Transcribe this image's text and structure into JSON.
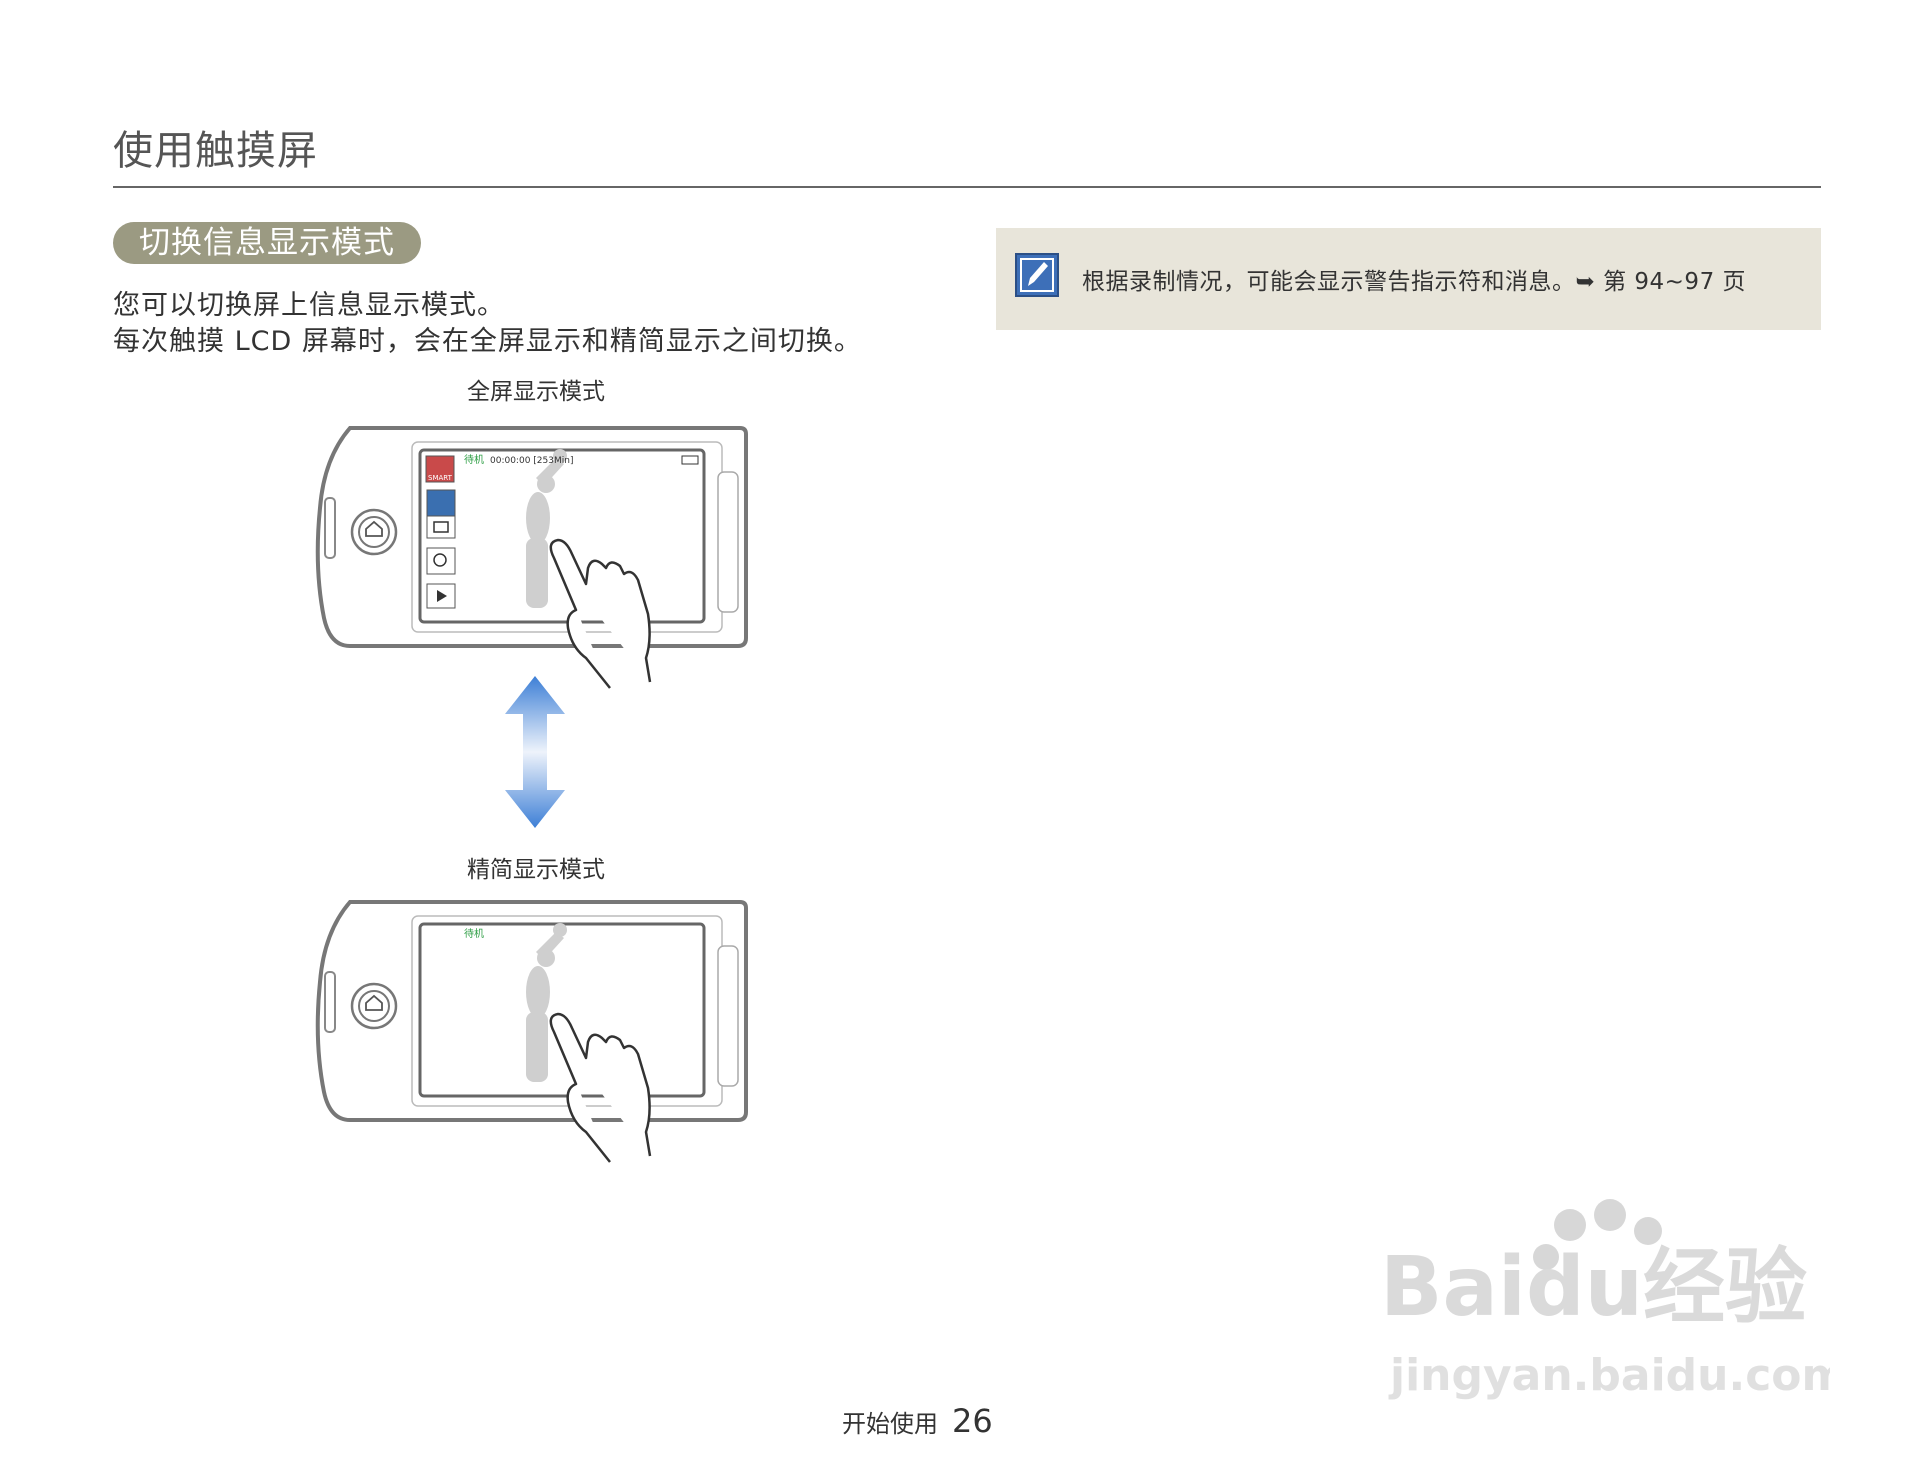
{
  "header": {
    "title": "使用触摸屏"
  },
  "section": {
    "badge": "切换信息显示模式",
    "lines": [
      "您可以切换屏上信息显示模式。",
      "每次触摸 LCD 屏幕时，会在全屏显示和精简显示之间切换。"
    ]
  },
  "figures": {
    "full": {
      "caption": "全屏显示模式",
      "status_label": "待机",
      "status_time": "00:00:00 [253Min]",
      "smart_label": "SMART"
    },
    "simple": {
      "caption": "精简显示模式",
      "status_label": "待机"
    }
  },
  "note": {
    "text": "根据录制情况，可能会显示警告指示符和消息。➥ 第 94~97 页"
  },
  "footer": {
    "section": "开始使用",
    "page": "26"
  },
  "watermark": {
    "brand": "Baidu经验",
    "url": "jingyan.baidu.com"
  },
  "colors": {
    "badge": "#9b9a82",
    "note_bg": "#e8e5da",
    "status_green": "#2e9e45",
    "arrow_blue": "#3d7fd6"
  }
}
